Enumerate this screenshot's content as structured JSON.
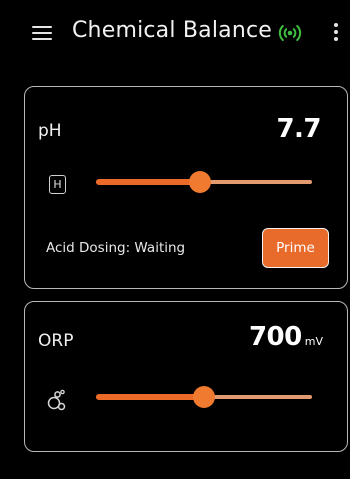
{
  "header": {
    "title": "Chemical Balance",
    "menu_icon": "hamburger-menu-icon",
    "status_icon": "wireless-signal-icon",
    "status_color": "#3fbf3f",
    "more_icon": "more-vertical-icon"
  },
  "colors": {
    "background": "#000000",
    "accent": "#ec6a28",
    "track_light": "#e29a6f",
    "card_border": "#b8b8b8"
  },
  "ph": {
    "label": "pH",
    "value": "7.7",
    "badge": "H",
    "slider_level": 0.48,
    "status": "Acid Dosing: Waiting",
    "prime_label": "Prime"
  },
  "orp": {
    "label": "ORP",
    "value": "700",
    "unit": "mV",
    "icon": "bubbles-icon",
    "slider_level": 0.5
  }
}
